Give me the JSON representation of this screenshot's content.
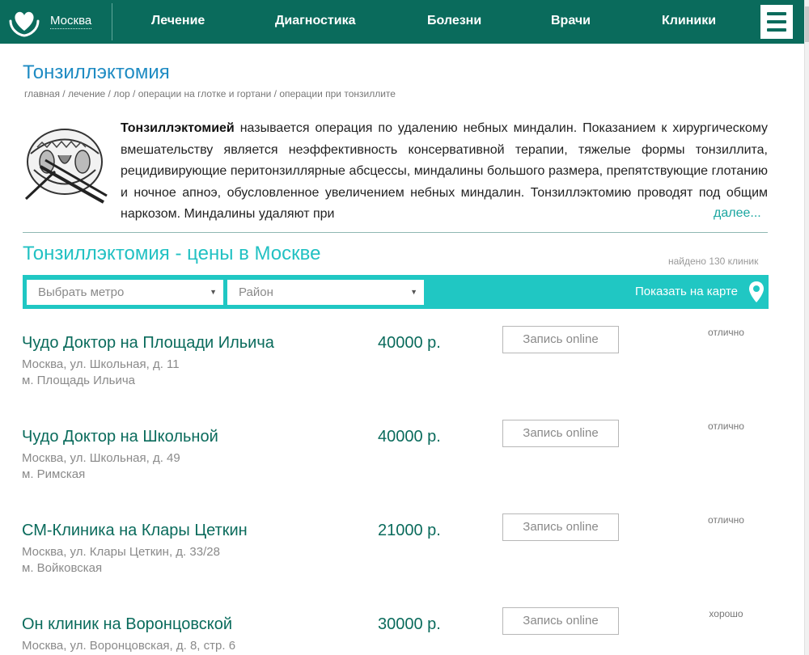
{
  "header": {
    "city": "Москва",
    "nav": [
      "Лечение",
      "Диагностика",
      "Болезни",
      "Врачи",
      "Клиники"
    ]
  },
  "page": {
    "title": "Тонзиллэктомия",
    "breadcrumbs": [
      "главная",
      "лечение",
      "лор",
      "операции на глотке и гортани",
      "операции при тонзиллите"
    ],
    "intro_bold": "Тонзиллэктомией",
    "intro_text": " называется операция по удалению небных миндалин. Показанием к хирургическому вмешательству является неэффективность консервативной терапии, тяжелые формы тонзиллита, рецидивирующие перитонзиллярные абсцессы, миндалины большого размера, препятствующие глотанию и ночное апноэ, обусловленное увеличением небных миндалин. Тонзиллэктомию проводят под общим наркозом. Миндалины удаляют при",
    "more_link": "далее..."
  },
  "prices": {
    "title": "Тонзиллэктомия - цены в Москве",
    "found": "найдено 130 клиник"
  },
  "filter": {
    "metro_placeholder": "Выбрать метро",
    "district_placeholder": "Район",
    "map_link": "Показать на карте"
  },
  "clinics": [
    {
      "name": "Чудо Доктор на Площади Ильича",
      "address": "Москва, ул. Школьная, д. 11",
      "metro": "м. Площадь Ильича",
      "price": "40000 р.",
      "button": "Запись online",
      "rating": "отлично"
    },
    {
      "name": "Чудо Доктор на Школьной",
      "address": "Москва, ул. Школьная, д. 49",
      "metro": "м. Римская",
      "price": "40000 р.",
      "button": "Запись online",
      "rating": "отлично"
    },
    {
      "name": "СМ-Клиника на Клары Цеткин",
      "address": "Москва, ул. Клары Цеткин, д. 33/28",
      "metro": "м. Войковская",
      "price": "21000 р.",
      "button": "Запись online",
      "rating": "отлично"
    },
    {
      "name": "Он клиник на Воронцовской",
      "address": "Москва, ул. Воронцовская, д. 8, стр. 6",
      "metro": "",
      "price": "30000 р.",
      "button": "Запись online",
      "rating": "хорошо"
    }
  ],
  "colors": {
    "header_bg": "#0a6b5c",
    "title_blue": "#1e8bc3",
    "accent_teal": "#20c7c3",
    "link_teal": "#1aa6a0"
  },
  "icons": [
    "heart-hands-logo-icon",
    "hamburger-menu-icon",
    "map-pin-icon",
    "chevron-down-icon",
    "tonsillectomy-illustration"
  ]
}
